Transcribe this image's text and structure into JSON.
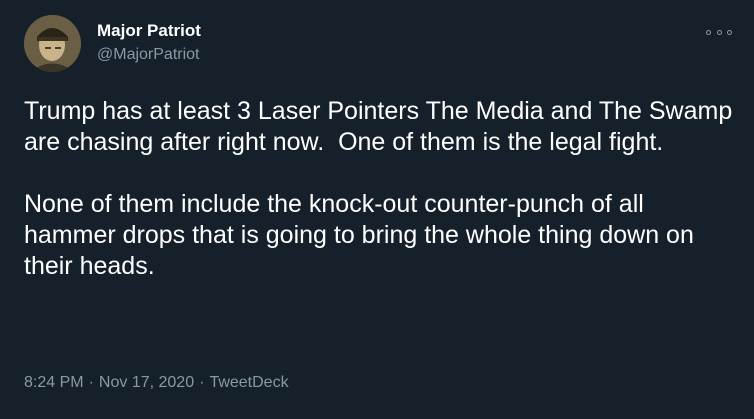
{
  "tweet": {
    "author": {
      "name": "Major Patriot",
      "handle": "@MajorPatriot",
      "avatar_icon": "profile-avatar"
    },
    "menu_icon": "more-options-icon",
    "text": {
      "paragraph_1": "Trump has at least 3 Laser Pointers The Media and The Swamp are chasing after right now.  One of them is the legal fight.",
      "paragraph_2": "None of them include the knock-out counter-punch of all hammer drops that is going to bring the whole thing down on their heads."
    },
    "meta": {
      "time": "8:24 PM",
      "separator": "·",
      "date": "Nov 17, 2020",
      "source": "TweetDeck"
    }
  },
  "colors": {
    "background": "#15202b",
    "primary_text": "#ffffff",
    "secondary_text": "#8899a6"
  }
}
